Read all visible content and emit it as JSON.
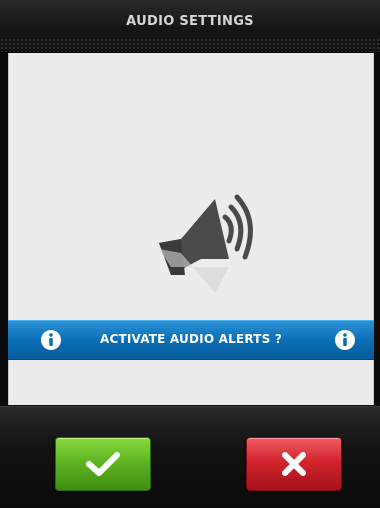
{
  "header": {
    "title": "AUDIO SETTINGS"
  },
  "main": {
    "illustration_icon": "speaker-sound-icon"
  },
  "info_bar": {
    "text": "ACTIVATE AUDIO ALERTS ?",
    "left_icon": "info-icon",
    "right_icon": "info-icon"
  },
  "footer": {
    "confirm_icon": "checkmark-icon",
    "cancel_icon": "close-icon"
  },
  "colors": {
    "info_bar": "#0a6fb6",
    "confirm": "#5fb524",
    "cancel": "#d2242d",
    "panel": "#ececec"
  }
}
